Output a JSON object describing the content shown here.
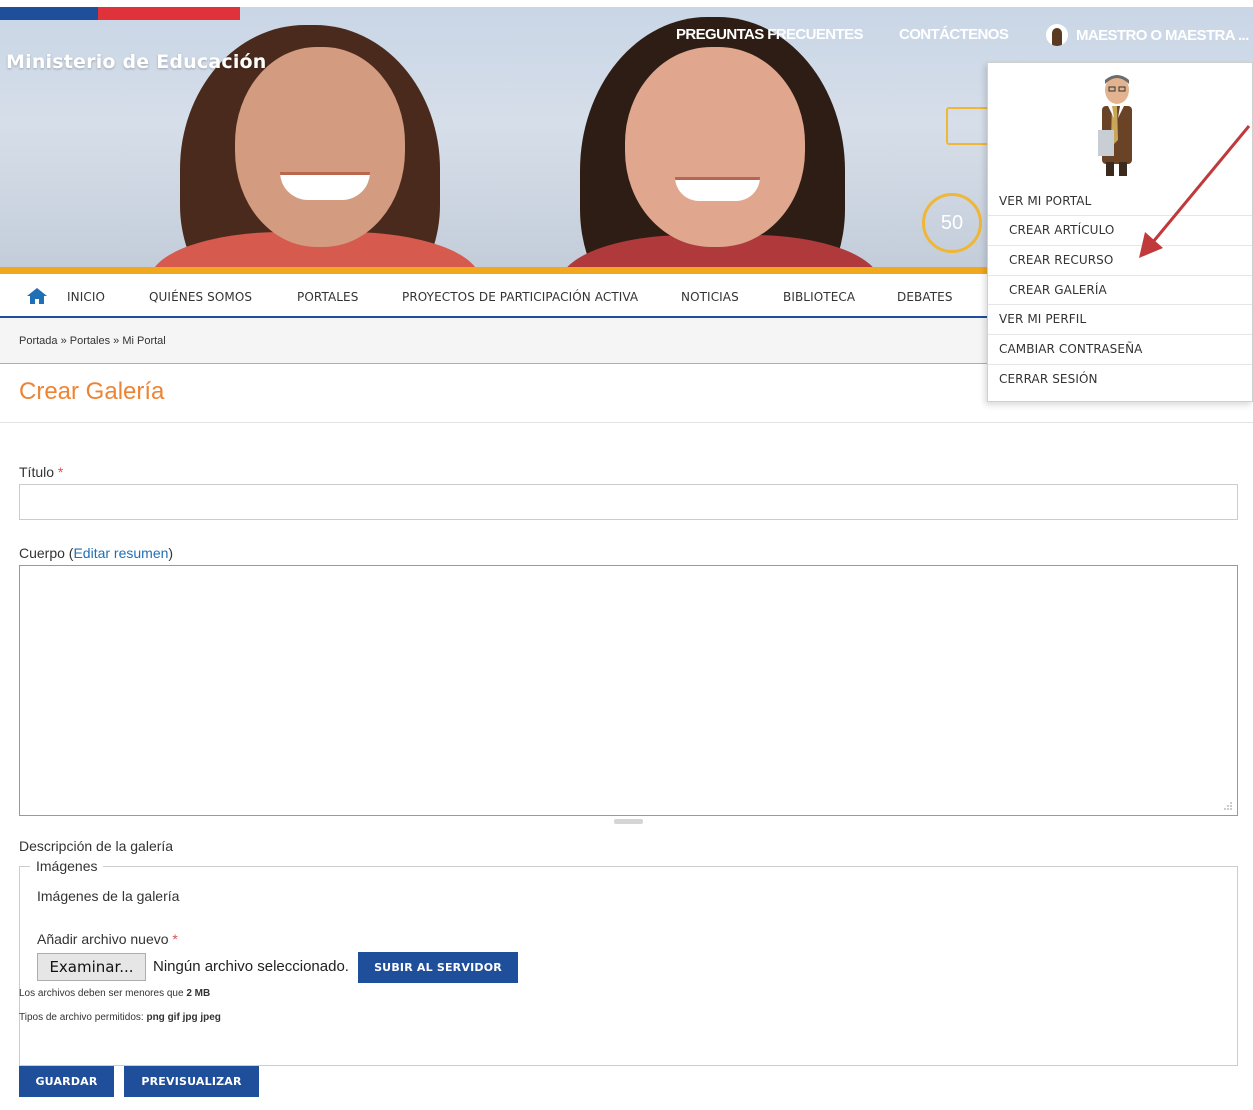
{
  "header": {
    "brand": "Ministerio de Educación",
    "faq": "PREGUNTAS FRECUENTES",
    "contact": "CONTÁCTENOS",
    "user": "MAESTRO O MAESTRA ...",
    "badge": "50"
  },
  "nav": {
    "items": [
      "INICIO",
      "QUIÉNES SOMOS",
      "PORTALES",
      "PROYECTOS DE PARTICIPACIÓN ACTIVA",
      "NOTICIAS",
      "BIBLIOTECA",
      "DEBATES"
    ]
  },
  "breadcrumb": "Portada » Portales » Mi Portal",
  "page_title": "Crear Galería",
  "form": {
    "title_label": "Título",
    "required_mark": "*",
    "body_label": "Cuerpo (",
    "body_link": "Editar resumen",
    "body_label_end": ")",
    "description_label": "Descripción de la galería",
    "fieldset_legend": "Imágenes",
    "images_label": "Imágenes de la galería",
    "add_file_label": "Añadir archivo nuevo",
    "browse_button": "Examinar...",
    "no_file": "Ningún archivo seleccionado.",
    "upload_button": "SUBIR AL SERVIDOR",
    "size_hint_prefix": "Los archivos deben ser menores que",
    "size_hint_value": "2 MB",
    "types_hint_prefix": "Tipos de archivo permitidos:",
    "types_hint_value": "png gif jpg jpeg",
    "save_button": "GUARDAR",
    "preview_button": "PREVISUALIZAR"
  },
  "dropdown": {
    "items": [
      {
        "label": "VER MI PORTAL"
      },
      {
        "label": "CREAR ARTÍCULO"
      },
      {
        "label": "CREAR RECURSO"
      },
      {
        "label": "CREAR GALERÍA"
      },
      {
        "label": "VER MI PERFIL"
      },
      {
        "label": "CAMBIAR CONTRASEÑA"
      },
      {
        "label": "CERRAR SESIÓN"
      }
    ]
  },
  "colors": {
    "accent_orange": "#ee8433",
    "nav_blue": "#1f4e9b",
    "arrow_red": "#c0393b"
  }
}
